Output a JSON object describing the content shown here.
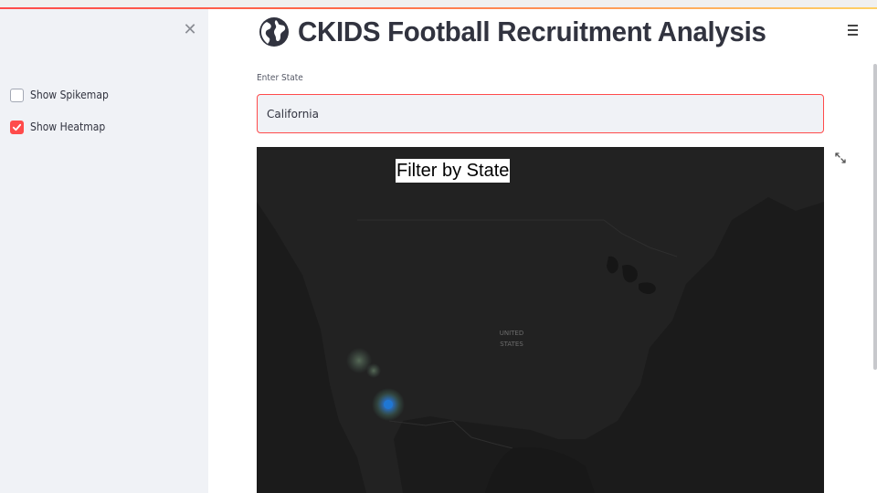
{
  "sidebar": {
    "close_icon": "close-icon",
    "checkboxes": [
      {
        "label": "Show Spikemap",
        "checked": false
      },
      {
        "label": "Show Heatmap",
        "checked": true
      }
    ]
  },
  "header": {
    "icon": "globe-icon",
    "title": "CKIDS Football Recruitment Analysis",
    "menu_icon": "hamburger-menu-icon"
  },
  "state_input": {
    "label": "Enter State",
    "value": "California"
  },
  "map": {
    "title": "Filter by State",
    "country_label_line1": "UNITED",
    "country_label_line2": "STATES",
    "expand_icon": "expand-icon"
  },
  "colors": {
    "accent": "#ff4b4b",
    "sidebar_bg": "#f0f2f6",
    "map_bg": "#1b1b1b",
    "heat_point": "#1f77d4"
  }
}
